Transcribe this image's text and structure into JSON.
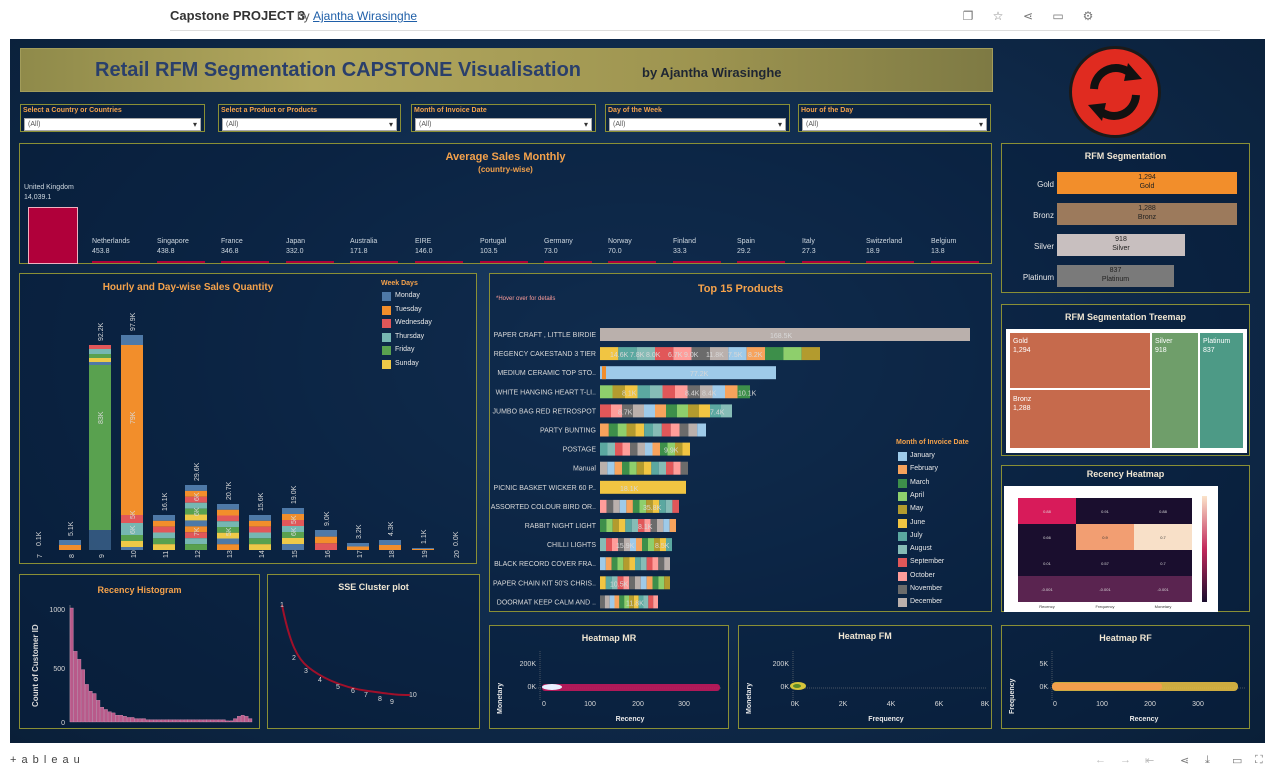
{
  "header": {
    "title": "Capstone PROJECT 3",
    "by": "by",
    "author": "Ajantha Wirasinghe"
  },
  "dashboard": {
    "title": "Retail RFM Segmentation CAPSTONE Visualisation",
    "byline": "by Ajantha Wirasinghe"
  },
  "filters": [
    {
      "label": "Select a Country or Countries",
      "value": "(All)"
    },
    {
      "label": "Select a Product or Products",
      "value": "(All)"
    },
    {
      "label": "Month of Invoice Date",
      "value": "(All)"
    },
    {
      "label": "Day of the Week",
      "value": "(All)"
    },
    {
      "label": "Hour of the Day",
      "value": "(All)"
    }
  ],
  "avg_sales": {
    "title": "Average Sales Monthly",
    "subtitle": "(country-wise)",
    "countries": [
      {
        "name": "United Kingdom",
        "value": "14,039.1"
      },
      {
        "name": "Netherlands",
        "value": "453.8"
      },
      {
        "name": "Singapore",
        "value": "438.8"
      },
      {
        "name": "France",
        "value": "346.8"
      },
      {
        "name": "Japan",
        "value": "332.0"
      },
      {
        "name": "Australia",
        "value": "171.8"
      },
      {
        "name": "EIRE",
        "value": "146.0"
      },
      {
        "name": "Portugal",
        "value": "103.5"
      },
      {
        "name": "Germany",
        "value": "73.0"
      },
      {
        "name": "Norway",
        "value": "70.0"
      },
      {
        "name": "Finland",
        "value": "33.3"
      },
      {
        "name": "Spain",
        "value": "29.2"
      },
      {
        "name": "Italy",
        "value": "27.3"
      },
      {
        "name": "Switzerland",
        "value": "18.9"
      },
      {
        "name": "Belgium",
        "value": "13.8"
      }
    ]
  },
  "hourly": {
    "title": "Hourly and Day-wise Sales Quantity",
    "legend_title": "Week Days",
    "legend": [
      {
        "name": "Monday",
        "color": "#4e79a7"
      },
      {
        "name": "Tuesday",
        "color": "#f28e2b"
      },
      {
        "name": "Wednesday",
        "color": "#e15759"
      },
      {
        "name": "Thursday",
        "color": "#76b7b2"
      },
      {
        "name": "Friday",
        "color": "#59a14f"
      },
      {
        "name": "Sunday",
        "color": "#edc948"
      }
    ],
    "hours": [
      "7",
      "8",
      "9",
      "10",
      "11",
      "12",
      "13",
      "14",
      "15",
      "16",
      "17",
      "18",
      "19",
      "20"
    ],
    "totals": [
      "0.1K",
      "5.1K",
      "92.2K",
      "97.9K",
      "16.1K",
      "29.6K",
      "20.7K",
      "15.6K",
      "19.0K",
      "9.0K",
      "3.2K",
      "4.3K",
      "1.1K",
      "0.0K"
    ],
    "inner": [
      {
        "hour": "9",
        "text": "83K"
      },
      {
        "hour": "10",
        "text": "79K"
      },
      {
        "hour": "10",
        "text": "6K"
      },
      {
        "hour": "10",
        "text": "5K"
      },
      {
        "hour": "12",
        "text": "7K"
      },
      {
        "hour": "12",
        "text": "6K"
      },
      {
        "hour": "12",
        "text": "6K"
      },
      {
        "hour": "13",
        "text": "5K"
      },
      {
        "hour": "15",
        "text": "6K"
      },
      {
        "hour": "15",
        "text": "5K"
      }
    ]
  },
  "top15": {
    "title": "Top 15 Products",
    "hint": "*Hover over for details",
    "legend_title": "Month of Invoice Date",
    "products": [
      "PAPER CRAFT , LITTLE BIRDIE",
      "REGENCY CAKESTAND 3 TIER",
      "MEDIUM CERAMIC TOP STO..",
      "WHITE HANGING HEART T-LI..",
      "JUMBO BAG RED RETROSPOT",
      "PARTY BUNTING",
      "POSTAGE",
      "Manual",
      "PICNIC BASKET WICKER 60 P..",
      "ASSORTED COLOUR BIRD OR..",
      "RABBIT NIGHT LIGHT",
      "CHILLI LIGHTS",
      "BLACK RECORD COVER FRA..",
      "PAPER CHAIN KIT 50'S CHRIS..",
      "DOORMAT KEEP CALM AND .."
    ],
    "labels": [
      "168.5K",
      "14.6K",
      "7.8K",
      "8.0K",
      "6.7K",
      "9.0K",
      "11.8K",
      "7.5K",
      "8.2K",
      "77.2K",
      "8.1K",
      "8.4K",
      "8.4K",
      "10.1K",
      "8.7K",
      "7.4K",
      "9.9K",
      "18.1K",
      "35.8K",
      "8.1K",
      "15.9K",
      "8.5K",
      "10.5K",
      "11.8K"
    ],
    "months": [
      {
        "name": "January",
        "color": "#9ecae9"
      },
      {
        "name": "February",
        "color": "#f7a35c"
      },
      {
        "name": "March",
        "color": "#3d8f4a"
      },
      {
        "name": "April",
        "color": "#8ecf6c"
      },
      {
        "name": "May",
        "color": "#b39b2e"
      },
      {
        "name": "June",
        "color": "#f1c542"
      },
      {
        "name": "July",
        "color": "#5ba8a0"
      },
      {
        "name": "August",
        "color": "#86bcb6"
      },
      {
        "name": "September",
        "color": "#e15759"
      },
      {
        "name": "October",
        "color": "#ff9d9a"
      },
      {
        "name": "November",
        "color": "#6b6b6b"
      },
      {
        "name": "December",
        "color": "#bab0ac"
      }
    ]
  },
  "rfm": {
    "title": "RFM Segmentation",
    "rows": [
      {
        "name": "Gold",
        "value": "1,294",
        "seg": "Gold",
        "color": "#f28e2b"
      },
      {
        "name": "Bronz",
        "value": "1,288",
        "seg": "Bronz",
        "color": "#9c7a5c"
      },
      {
        "name": "Silver",
        "value": "918",
        "seg": "Silver",
        "color": "#c8bfbf"
      },
      {
        "name": "Platinum",
        "value": "837",
        "seg": "Platinum",
        "color": "#7a7a7a"
      }
    ]
  },
  "treemap": {
    "title": "RFM Segmentation Treemap",
    "cells": [
      {
        "name": "Gold",
        "value": "1,294"
      },
      {
        "name": "Silver",
        "value": "918"
      },
      {
        "name": "Platinum",
        "value": "837"
      },
      {
        "name": "Bronz",
        "value": "1,288"
      }
    ]
  },
  "recency_heatmap": {
    "title": "Recency Heatmap",
    "cells": [
      "0.88",
      "0.91",
      "0.88",
      "0.66",
      "0.9",
      "0.7",
      "0.01",
      "0.57",
      "0.7",
      "-0.001",
      "-0.001",
      "-0.001"
    ],
    "x": [
      "Recency",
      "Frequency",
      "Monetary"
    ],
    "y": [
      "Recency",
      "Frequency",
      "Monetary"
    ]
  },
  "recency_hist": {
    "title": "Recency Histogram",
    "ylabel": "Count of Customer ID",
    "yticks": [
      "1000",
      "500",
      "0"
    ]
  },
  "sse": {
    "title": "SSE Cluster plot",
    "labels": [
      "1",
      "2",
      "3",
      "4",
      "5",
      "6",
      "7",
      "8",
      "9",
      "10"
    ]
  },
  "hm_mr": {
    "title": "Heatmap MR",
    "ylabel": "Monetary",
    "xlabel": "Recency",
    "yticks": [
      "200K",
      "0K"
    ],
    "xticks": [
      "0",
      "100",
      "200",
      "300"
    ]
  },
  "hm_fm": {
    "title": "Heatmap FM",
    "ylabel": "Monetary",
    "xlabel": "Frequency",
    "yticks": [
      "200K",
      "0K"
    ],
    "xticks": [
      "0K",
      "2K",
      "4K",
      "6K",
      "8K"
    ]
  },
  "hm_rf": {
    "title": "Heatmap RF",
    "ylabel": "Frequency",
    "xlabel": "Recency",
    "yticks": [
      "5K",
      "0K"
    ],
    "xticks": [
      "0",
      "100",
      "200",
      "300"
    ]
  },
  "footer": {
    "brand": "+ a b l e a u"
  }
}
